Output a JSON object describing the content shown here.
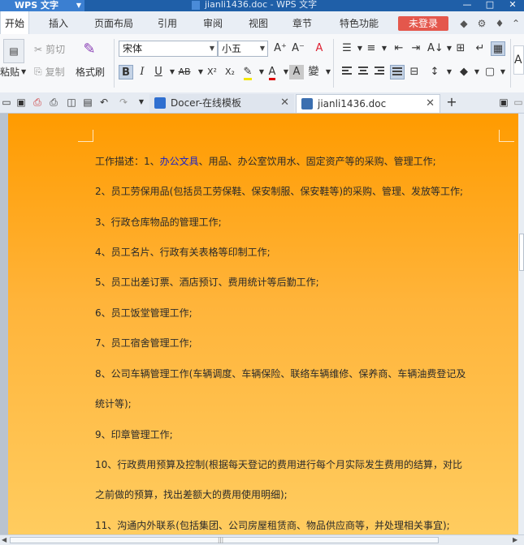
{
  "app": {
    "name": "WPS 文字",
    "title": "jianli1436.doc - WPS 文字"
  },
  "menu": {
    "tabs": [
      "开始",
      "插入",
      "页面布局",
      "引用",
      "审阅",
      "视图",
      "章节",
      "特色功能"
    ],
    "login": "未登录"
  },
  "ribbon": {
    "cut": "剪切",
    "copy": "复制",
    "paste": "粘贴",
    "format_painter": "格式刷",
    "font_name": "宋体",
    "font_size": "小五",
    "bold": "B",
    "italic": "I",
    "underline": "U",
    "strike": "AB",
    "superscript": "X²",
    "subscript": "X₂",
    "font_color": "A",
    "char_shading": "A",
    "phonetic": "變"
  },
  "tabs": [
    {
      "label": "Docer-在线模板",
      "active": false
    },
    {
      "label": "jianli1436.doc",
      "active": true
    }
  ],
  "document": {
    "lines": [
      {
        "prefix": "工作描述：1、",
        "highlight": "办公文具",
        "rest": "、用品、办公室饮用水、固定资产等的采购、管理工作;"
      },
      {
        "text": "2、员工劳保用品(包括员工劳保鞋、保安制服、保安鞋等)的采购、管理、发放等工作;"
      },
      {
        "text": "3、行政仓库物品的管理工作;"
      },
      {
        "text": "4、员工名片、行政有关表格等印制工作;"
      },
      {
        "text": "5、员工出差订票、酒店预订、费用统计等后勤工作;"
      },
      {
        "text": "6、员工饭堂管理工作;"
      },
      {
        "text": "7、员工宿舍管理工作;"
      },
      {
        "text": "8、公司车辆管理工作(车辆调度、车辆保险、联络车辆维修、保养商、车辆油费登记及"
      },
      {
        "text": "统计等);"
      },
      {
        "text": "9、印章管理工作;"
      },
      {
        "text": "10、行政费用预算及控制(根据每天登记的费用进行每个月实际发生费用的结算，对比"
      },
      {
        "text": "之前做的预算，找出差额大的费用使用明细);"
      },
      {
        "text": "11、沟通内外联系(包括集团、公司房屋租赁商、物品供应商等，并处理相关事宜);"
      }
    ]
  }
}
